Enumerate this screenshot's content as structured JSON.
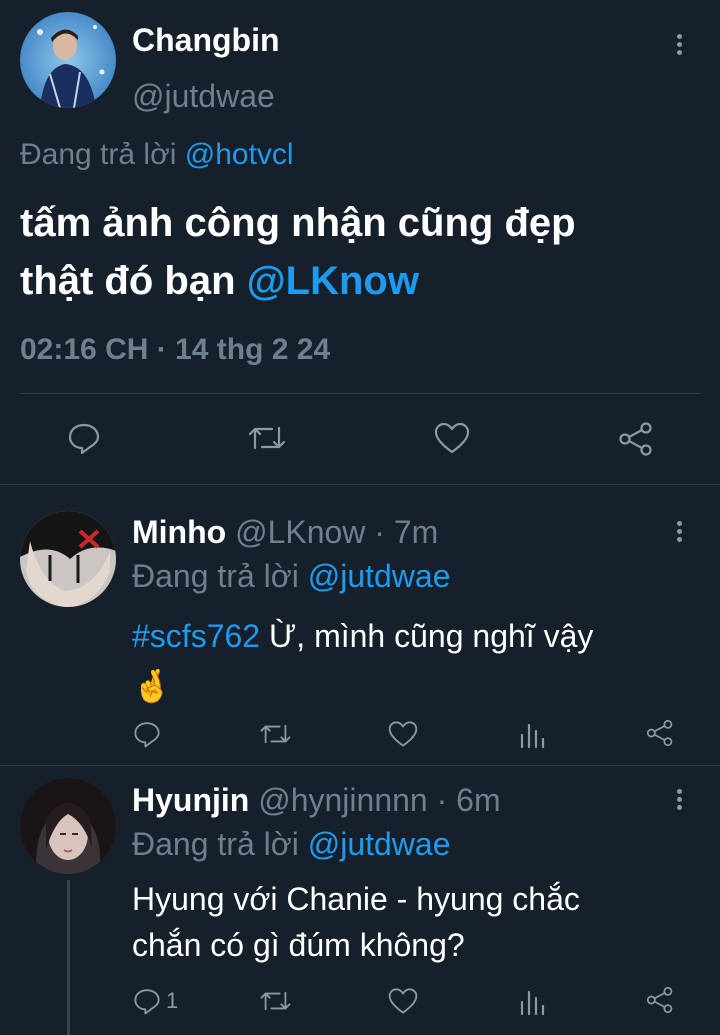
{
  "main_tweet": {
    "display_name": "Changbin",
    "handle": "@jutdwae",
    "reply_prefix": "Đang trả lời",
    "reply_to": "@hotvcl",
    "text_line1": "tấm ảnh công nhận cũng đẹp",
    "text_line2": "thật đó bạn",
    "mention": "@LKnow",
    "timestamp": "02:16 CH · 14 thg 2 24"
  },
  "replies": [
    {
      "display_name": "Minho",
      "handle": "@LKnow",
      "separator": " · ",
      "time": "7m",
      "reply_prefix": "Đang trả lời",
      "reply_to": "@jutdwae",
      "hashtag": "#scfs762",
      "text": " Ừ, mình cũng nghĩ vậy",
      "emoji": "🤞",
      "reply_count": ""
    },
    {
      "display_name": "Hyunjin",
      "handle": "@hynjinnnn",
      "separator": " · ",
      "time": "6m",
      "reply_prefix": "Đang trả lời",
      "reply_to": "@jutdwae",
      "text_line1": "Hyung với Chanie - hyung chắc",
      "text_line2": "chắn có gì đúm không?",
      "reply_count": "1"
    }
  ],
  "colors": {
    "background": "#15202b",
    "accent": "#1d9bf0",
    "muted": "#6e7f8f"
  }
}
